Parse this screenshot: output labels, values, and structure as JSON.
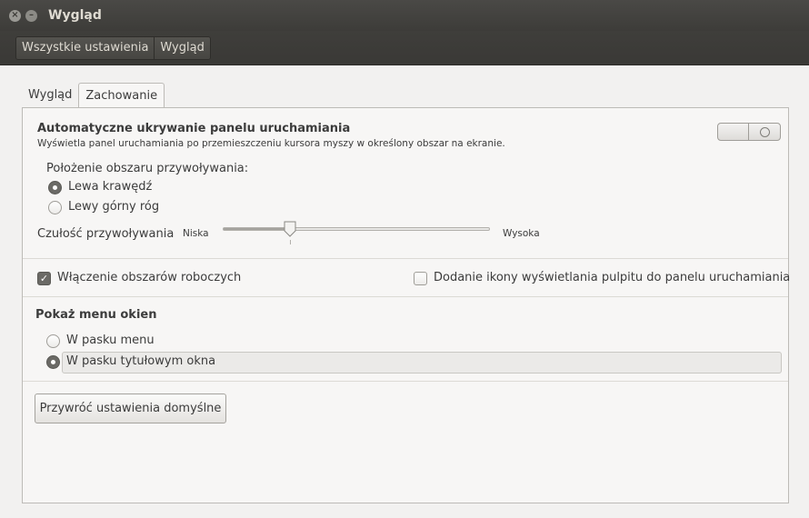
{
  "window": {
    "title": "Wygląd"
  },
  "breadcrumbs": [
    "Wszystkie ustawienia",
    "Wygląd"
  ],
  "tabs": [
    {
      "label": "Wygląd",
      "active": false
    },
    {
      "label": "Zachowanie",
      "active": true
    }
  ],
  "autohide": {
    "title": "Automatyczne ukrywanie panelu uruchamiania",
    "description": "Wyświetla panel uruchamiania po przemieszczeniu kursora myszy w określony obszar na ekranie.",
    "enabled": false,
    "location_label": "Położenie obszaru przywoływania:",
    "options": [
      {
        "label": "Lewa krawędź",
        "selected": true
      },
      {
        "label": "Lewy górny róg",
        "selected": false
      }
    ],
    "sensitivity_label": "Czułość przywoływania",
    "sensitivity_low": "Niska",
    "sensitivity_high": "Wysoka",
    "sensitivity_value": 0.25
  },
  "workspaces": {
    "label": "Włączenie obszarów roboczych",
    "checked": true
  },
  "desktop_icon": {
    "label": "Dodanie ikony wyświetlania pulpitu do panelu uruchamiania",
    "checked": false
  },
  "window_menus": {
    "title": "Pokaż menu okien",
    "options": [
      {
        "label": "W pasku menu",
        "selected": false
      },
      {
        "label": "W pasku tytułowym okna",
        "selected": true
      }
    ]
  },
  "restore_button": "Przywróć ustawienia domyślne"
}
